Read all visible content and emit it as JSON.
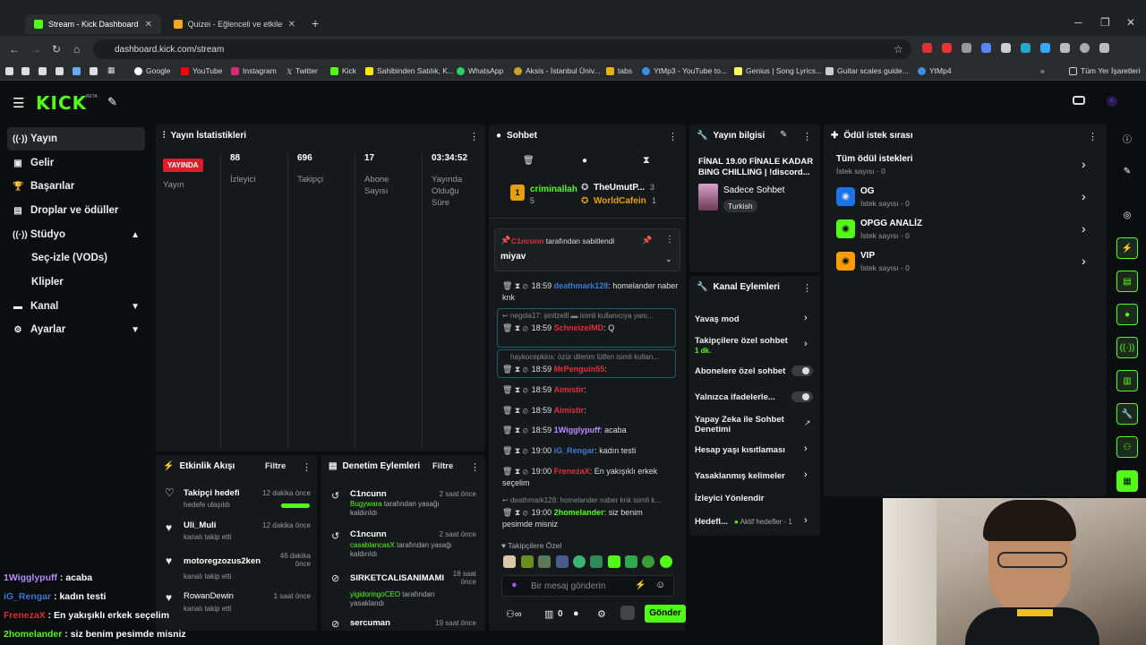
{
  "browser": {
    "tabs": [
      {
        "title": "Stream - Kick Dashboard",
        "active": true
      },
      {
        "title": "Quizei - Eğlenceli ve etkileşimli",
        "active": false
      }
    ],
    "url": "dashboard.kick.com/stream",
    "bookmarks": [
      "Google",
      "YouTube",
      "Instagram",
      "Twitter",
      "Kick",
      "Sahibinden Satılık, K...",
      "WhatsApp",
      "Aksis - İstanbul Üniv...",
      "tabs",
      "YtMp3 - YouTube to...",
      "Genius | Song Lyrics...",
      "Guitar scales guide...",
      "YtMp4"
    ],
    "all_bookmarks": "Tüm Yer İşaretleri"
  },
  "kick": {
    "logo": "KICK",
    "beta": "BETA"
  },
  "sidebar": {
    "items": [
      "Yayın",
      "Gelir",
      "Başarılar",
      "Droplar ve ödüller",
      "Stüdyo",
      "Kanal",
      "Ayarlar"
    ],
    "studio_sub": [
      "Seç-izle (VODs)",
      "Klipler"
    ]
  },
  "stats": {
    "title": "Yayın İstatistikleri",
    "live_badge": "YAYINDA",
    "live_label": "Yayın",
    "viewers": "88",
    "viewers_label": "İzleyici",
    "followers": "696",
    "followers_label": "Takipçi",
    "subs": "17",
    "subs_label": "Abone Sayısı",
    "uptime": "03:34:52",
    "uptime_label": "Yayında Olduğu Süre"
  },
  "activity": {
    "title": "Etkinlik Akışı",
    "filter": "Filtre",
    "items": [
      {
        "name": "Takipçi hedefi",
        "sub": "hedefe ulaşıldı",
        "time": "12 dakika önce"
      },
      {
        "name": "Uli_Muli",
        "sub": "kanalı takip etti",
        "time": "12 dakika önce"
      },
      {
        "name": "motoregzozus2ken",
        "sub": "kanalı takip etti",
        "time": "46 dakika önce"
      },
      {
        "name": "RowanDewin",
        "sub": "kanalı takip etti",
        "time": "1 saat önce"
      }
    ]
  },
  "moderation": {
    "title": "Denetim Eylemleri",
    "filter": "Filtre",
    "items": [
      {
        "name": "C1ncunn",
        "who": "Bugywara",
        "sub": "tarafından yasağı kaldırıldı",
        "time": "2 saat önce"
      },
      {
        "name": "C1ncunn",
        "who": "casablancasX",
        "sub": "tarafından yasağı kaldırıldı",
        "time": "2 saat önce"
      },
      {
        "name": "SIRKETCALISANIMAMI",
        "who": "yigidoringoCEO",
        "sub": "tarafından yasaklandı",
        "time": "18 saat önce"
      },
      {
        "name": "sercuman",
        "who": "",
        "sub": "",
        "time": "19 saat önce"
      }
    ]
  },
  "chat": {
    "title": "Sohbet",
    "top_gifter": {
      "name": "criminallah",
      "count": "5",
      "rank": "1"
    },
    "gifters": [
      {
        "name": "TheUmutP...",
        "count": "3"
      },
      {
        "name": "WorldCafein",
        "count": "1"
      }
    ],
    "pinned_by": "C1ncunn",
    "pinned_suffix": "tarafından sabitlendi",
    "pinned_msg": "miyav",
    "messages": [
      {
        "time": "18:59",
        "user": "deathmark128",
        "color": "#3a7bd5",
        "text": ": homelander naber knk"
      },
      {
        "reply": "negola17: şinitzelll",
        "reply2": "isimli kullanıcıya yanı...",
        "time": "18:59",
        "user": "SchneizelMD",
        "color": "#e0303a",
        "text": ": Q"
      },
      {
        "reply": "haykocepkinx: özür dilerim lütfen isimli kullan...",
        "time": "18:59",
        "user": "MrPenguin55",
        "color": "#e0303a",
        "text": ":"
      },
      {
        "time": "18:59",
        "user": "Aimistir",
        "color": "#e0303a",
        "text": ":"
      },
      {
        "time": "18:59",
        "user": "Aimistir",
        "color": "#e0303a",
        "text": ":"
      },
      {
        "time": "18:59",
        "user": "1Wigglypuff",
        "color": "#b98cff",
        "text": ": acaba"
      },
      {
        "time": "19:00",
        "user": "iG_Rengar",
        "color": "#3a7bd5",
        "text": ": kadın testi"
      },
      {
        "time": "19:00",
        "user": "FrenezaX",
        "color": "#e0303a",
        "text": ": En yakışıklı erkek seçelim"
      },
      {
        "reply": "deathmark128: homelander naber knk isimli k...",
        "time": "19:00",
        "user": "2homelander",
        "color": "#53fc18",
        "text": ": siz benim pesimde misniz"
      }
    ],
    "follower_only": "Takipçilere Özel",
    "placeholder": "Bir mesaj gönderin",
    "count": "0",
    "send": "Gönder"
  },
  "stream_info": {
    "title": "Yayın bilgisi",
    "stream_title": "FİNAL 19.00 FİNALE KADAR BING CHILLING | !discord...",
    "category": "Sadece Sohbet",
    "tag": "Turkish"
  },
  "channel_actions": {
    "title": "Kanal Eylemleri",
    "items": [
      {
        "label": "Yavaş mod",
        "type": "arrow"
      },
      {
        "label": "Takipçilere özel sohbet",
        "sub": "1 dk.",
        "type": "arrow"
      },
      {
        "label": "Abonelere özel sohbet",
        "type": "toggle"
      },
      {
        "label": "Yalnızca ifadelerle...",
        "type": "toggle"
      },
      {
        "label": "Yapay Zeka ile Sohbet Denetimi",
        "type": "ext"
      },
      {
        "label": "Hesap yaşı kısıtlaması",
        "type": "arrow"
      },
      {
        "label": "Yasaklanmış kelimeler",
        "type": "arrow"
      },
      {
        "label": "İzleyici Yönlendir",
        "type": "none"
      },
      {
        "label": "Hedefl...",
        "sub": "Aktif hedefler - 1",
        "type": "arrow"
      }
    ]
  },
  "rewards": {
    "title": "Ödül istek sırası",
    "all": "Tüm ödül istekleri",
    "count_label": "İstek sayısı - 0",
    "items": [
      {
        "name": "OG",
        "color": "#1a73e8"
      },
      {
        "name": "OPGG ANALİZ",
        "color": "#53fc18"
      },
      {
        "name": "VIP",
        "color": "#ff9d00"
      }
    ]
  },
  "overlay_chat": [
    {
      "user": "1Wigglypuff",
      "color": "#b98cff",
      "text": " : acaba"
    },
    {
      "user": "iG_Rengar",
      "color": "#3a7bd5",
      "text": " : kadın testi"
    },
    {
      "user": "FrenezaX",
      "color": "#e0303a",
      "text": " : En yakışıklı erkek seçelim"
    },
    {
      "user": "2homelander",
      "color": "#53fc18",
      "text": " : siz benim pesimde misniz"
    }
  ]
}
